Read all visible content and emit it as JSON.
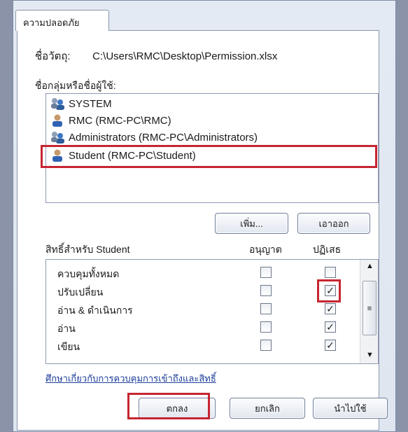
{
  "tab": {
    "label": "ความปลอดภัย"
  },
  "object": {
    "label": "ชื่อวัตถุ:",
    "value": "C:\\Users\\RMC\\Desktop\\Permission.xlsx"
  },
  "groups": {
    "label": "ชื่อกลุ่มหรือชื่อผู้ใช้:",
    "items": [
      {
        "name": "SYSTEM",
        "icon": "group-icon"
      },
      {
        "name": "RMC (RMC-PC\\RMC)",
        "icon": "user-icon"
      },
      {
        "name": "Administrators (RMC-PC\\Administrators)",
        "icon": "group-icon"
      },
      {
        "name": "Student (RMC-PC\\Student)",
        "icon": "user-icon",
        "selected": true
      }
    ]
  },
  "buttons": {
    "add": "เพิ่ม...",
    "remove": "เอาออก",
    "ok": "ตกลง",
    "cancel": "ยกเลิก",
    "apply": "นำไปใช้"
  },
  "permissions": {
    "header": "สิทธิ์สำหรับ Student",
    "allow_header": "อนุญาต",
    "deny_header": "ปฏิเสธ",
    "rows": [
      {
        "name": "ควบคุมทั้งหมด",
        "allow": false,
        "deny": false
      },
      {
        "name": "ปรับเปลี่ยน",
        "allow": false,
        "deny": true
      },
      {
        "name": "อ่าน & ดำเนินการ",
        "allow": false,
        "deny": true
      },
      {
        "name": "อ่าน",
        "allow": false,
        "deny": true
      },
      {
        "name": "เขียน",
        "allow": false,
        "deny": true
      }
    ]
  },
  "link": {
    "text": "ศึกษาเกี่ยวกับการควบคุมการเข้าถึงและสิทธิ์"
  },
  "colors": {
    "highlight": "#c62532",
    "link": "#1d3f9a"
  }
}
